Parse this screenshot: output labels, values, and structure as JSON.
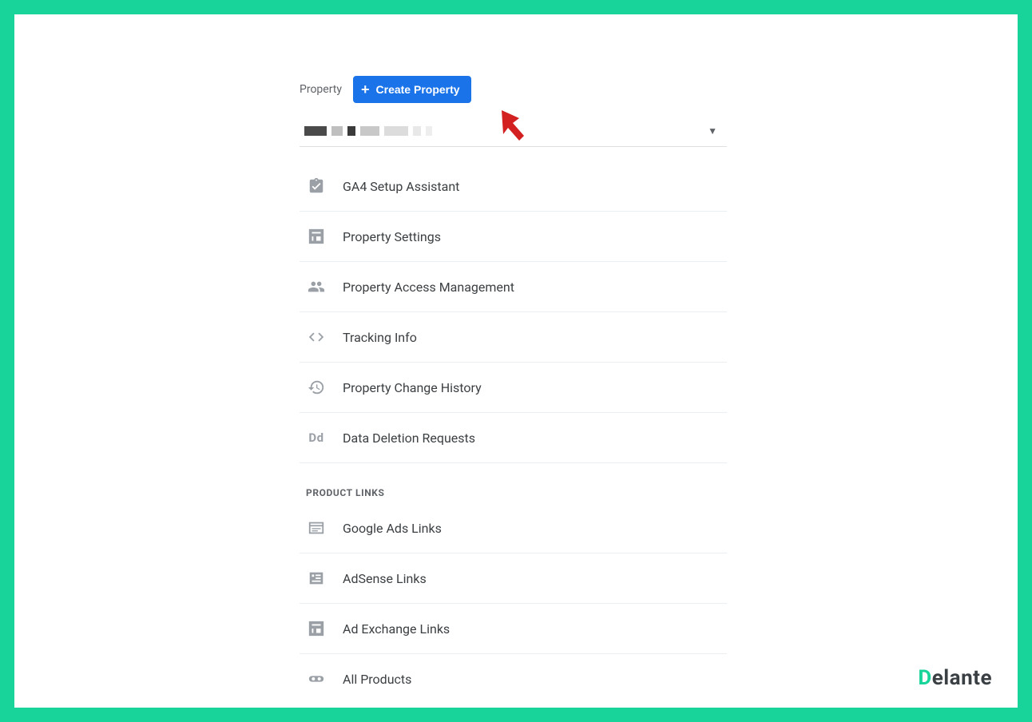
{
  "header": {
    "propertyLabel": "Property",
    "createButton": "Create Property"
  },
  "menu": {
    "items": [
      {
        "label": "GA4 Setup Assistant"
      },
      {
        "label": "Property Settings"
      },
      {
        "label": "Property Access Management"
      },
      {
        "label": "Tracking Info"
      },
      {
        "label": "Property Change History"
      },
      {
        "label": "Data Deletion Requests"
      }
    ],
    "sectionHeader": "PRODUCT LINKS",
    "productItems": [
      {
        "label": "Google Ads Links"
      },
      {
        "label": "AdSense Links"
      },
      {
        "label": "Ad Exchange Links"
      },
      {
        "label": "All Products"
      }
    ]
  },
  "logo": {
    "first": "D",
    "rest": "elante"
  },
  "colors": {
    "accent": "#18d49a",
    "primary": "#1a73e8"
  }
}
